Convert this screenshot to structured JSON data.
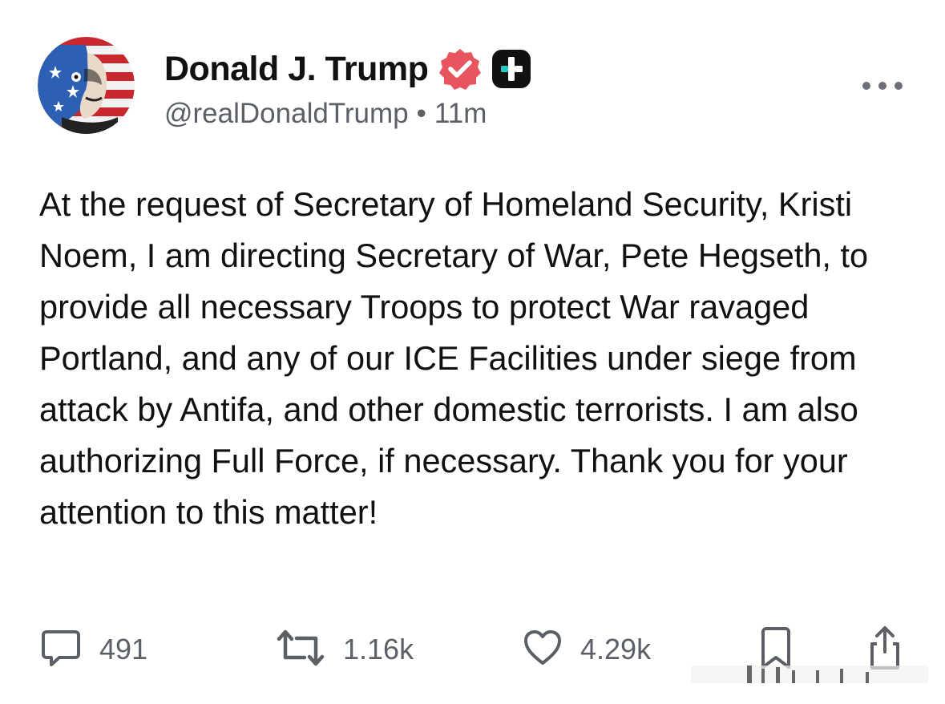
{
  "post": {
    "author": {
      "display_name": "Donald J. Trump",
      "handle": "@realDonaldTrump",
      "separator": "•",
      "time_ago": "11m",
      "avatar_icon": "avatar-flag-portrait",
      "verified_icon": "verified-badge-icon",
      "plus_icon": "plus-badge-icon"
    },
    "body": "At the request of Secretary of Homeland Security, Kristi Noem, I am directing Secretary of War, Pete Hegseth, to provide all necessary Troops to protect War ravaged Portland, and any of our ICE Facilities under siege from attack by Antifa, and other domestic terrorists. I am also authorizing Full Force, if necessary. Thank you for your attention to this matter!",
    "actions": {
      "reply": {
        "icon": "comment-icon",
        "count": "491"
      },
      "retruth": {
        "icon": "repost-icon",
        "count": "1.16k"
      },
      "like": {
        "icon": "heart-icon",
        "count": "4.29k"
      },
      "bookmark": {
        "icon": "bookmark-icon"
      },
      "share": {
        "icon": "share-icon"
      }
    },
    "colors": {
      "verified": "#e8555f",
      "muted_text": "#5b5f66",
      "plus_badge_bg": "#111111",
      "plus_badge_accent": "#27c7c0"
    }
  }
}
